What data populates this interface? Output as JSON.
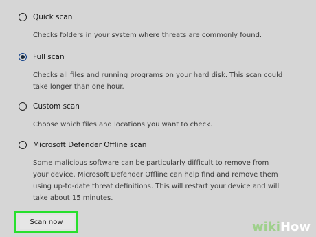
{
  "options": [
    {
      "label": "Quick scan",
      "description": "Checks folders in your system where threats are commonly found.",
      "selected": false
    },
    {
      "label": "Full scan",
      "description": "Checks all files and running programs on your hard disk. This scan could take longer than one hour.",
      "selected": true
    },
    {
      "label": "Custom scan",
      "description": "Choose which files and locations you want to check.",
      "selected": false
    },
    {
      "label": "Microsoft Defender Offline scan",
      "description": "Some malicious software can be particularly difficult to remove from your device. Microsoft Defender Offline can help find and remove them using up-to-date threat definitions. This will restart your device and will take about 15 minutes.",
      "selected": false
    }
  ],
  "actions": {
    "scan_now_label": "Scan now"
  },
  "watermark": {
    "wiki": "wiki",
    "how": "How"
  },
  "colors": {
    "background": "#d6d6d6",
    "highlight": "#27e02d",
    "radio_selected_border": "#0f3f88"
  }
}
